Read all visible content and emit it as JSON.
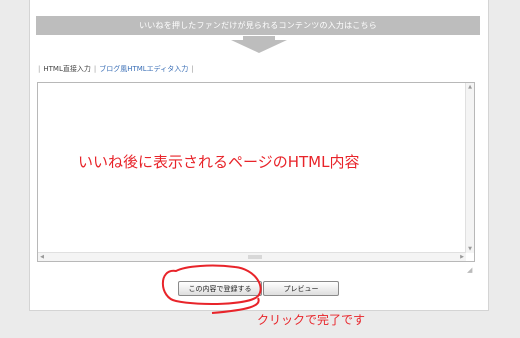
{
  "banner": {
    "text": "いいねを押したファンだけが見られるコンテンツの入力はこちら"
  },
  "tabs": {
    "sep": "|",
    "direct_input": "HTML直接入力",
    "blog_editor": "ブログ風HTMLエディタ入力"
  },
  "editor": {
    "content": "いいね後に表示されるページのHTML内容"
  },
  "buttons": {
    "register": "この内容で登録する",
    "preview": "プレビュー"
  },
  "annotation": {
    "note": "クリックで完了です",
    "color": "#e8242a"
  },
  "icons": {
    "down_arrow": "down-arrow-icon",
    "resize_grip": "resize-grip-icon"
  }
}
